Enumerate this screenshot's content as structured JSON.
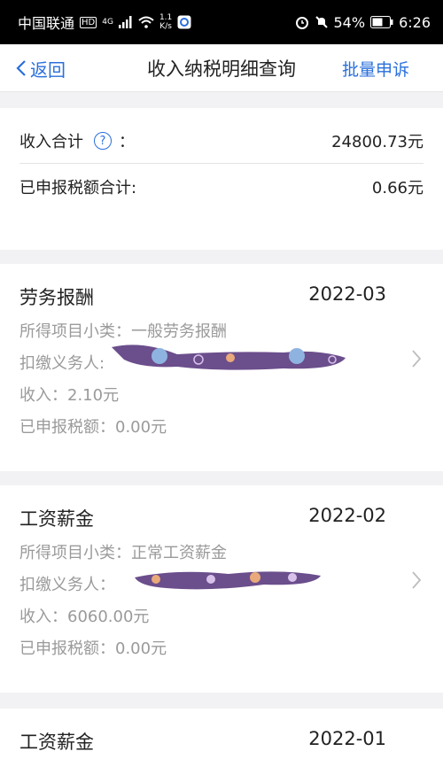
{
  "status_bar": {
    "carrier": "中国联通",
    "hd": "HD",
    "net_type": "4G",
    "speed_value": "1.1",
    "speed_unit": "K/s",
    "battery": "54%",
    "time": "6:26"
  },
  "navbar": {
    "back_label": "返回",
    "title": "收入纳税明细查询",
    "action_label": "批量申诉"
  },
  "summary": {
    "income_label": "收入合计",
    "help_glyph": "?",
    "colon": "：",
    "income_value": "24800.73元",
    "tax_label": "已申报税额合计:",
    "tax_value": "0.66元"
  },
  "records": [
    {
      "title": "劳务报酬",
      "date": "2022-03",
      "category": "所得项目小类：一般劳务报酬",
      "withholder_label": "扣缴义务人:",
      "income": "收入：2.10元",
      "tax": "已申报税额：0.00元"
    },
    {
      "title": "工资薪金",
      "date": "2022-02",
      "category": "所得项目小类：正常工资薪金",
      "withholder_label": "扣缴义务人：",
      "income": "收入：6060.00元",
      "tax": "已申报税额：0.00元"
    },
    {
      "title": "工资薪金",
      "date": "2022-01"
    }
  ],
  "colors": {
    "accent": "#2a6fdb",
    "scribble": "#6b4e8c"
  }
}
